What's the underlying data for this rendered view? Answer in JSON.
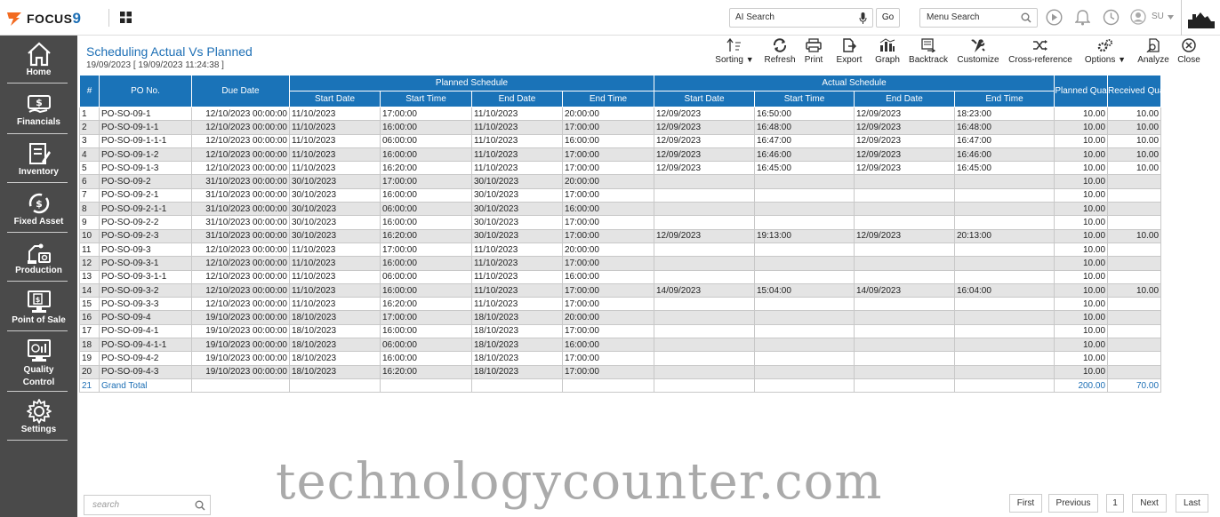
{
  "app": {
    "logo_text": "FOCUS",
    "logo_number": "9"
  },
  "topbar": {
    "ai_search_placeholder": "AI Search",
    "go_label": "Go",
    "menu_search_placeholder": "Menu Search",
    "user_initials": "SU"
  },
  "sidebar": {
    "items": [
      {
        "label": "Home",
        "icon": "home-icon"
      },
      {
        "label": "Financials",
        "icon": "financials-icon"
      },
      {
        "label": "Inventory",
        "icon": "inventory-icon"
      },
      {
        "label": "Fixed Asset",
        "icon": "fixed-asset-icon"
      },
      {
        "label": "Production",
        "icon": "production-icon"
      },
      {
        "label": "Point of Sale",
        "icon": "point-of-sale-icon"
      },
      {
        "label": "Quality Control",
        "icon": "quality-control-icon"
      },
      {
        "label": "Settings",
        "icon": "gear-icon"
      }
    ]
  },
  "report": {
    "title": "Scheduling Actual Vs Planned",
    "subtitle": "19/09/2023 [ 19/09/2023 11:24:38 ]"
  },
  "toolbar": {
    "sorting": "Sorting",
    "refresh": "Refresh",
    "print": "Print",
    "export": "Export",
    "graph": "Graph",
    "backtrack": "Backtrack",
    "customize": "Customize",
    "cross_reference": "Cross-reference",
    "options": "Options",
    "analyze": "Analyze",
    "close": "Close"
  },
  "table": {
    "headers": {
      "num": "#",
      "po_no": "PO No.",
      "due_date": "Due Date",
      "planned_group": "Planned Schedule",
      "actual_group": "Actual Schedule",
      "start_date": "Start Date",
      "start_time": "Start Time",
      "end_date": "End Date",
      "end_time": "End Time",
      "planned_qty": "Planned Qua",
      "received_qty": "Received Qua"
    },
    "rows": [
      [
        "1",
        "PO-SO-09-1",
        "12/10/2023 00:00:00",
        "11/10/2023",
        "17:00:00",
        "11/10/2023",
        "20:00:00",
        "12/09/2023",
        "16:50:00",
        "12/09/2023",
        "18:23:00",
        "10.00",
        "10.00"
      ],
      [
        "2",
        "PO-SO-09-1-1",
        "12/10/2023 00:00:00",
        "11/10/2023",
        "16:00:00",
        "11/10/2023",
        "17:00:00",
        "12/09/2023",
        "16:48:00",
        "12/09/2023",
        "16:48:00",
        "10.00",
        "10.00"
      ],
      [
        "3",
        "PO-SO-09-1-1-1",
        "12/10/2023 00:00:00",
        "11/10/2023",
        "06:00:00",
        "11/10/2023",
        "16:00:00",
        "12/09/2023",
        "16:47:00",
        "12/09/2023",
        "16:47:00",
        "10.00",
        "10.00"
      ],
      [
        "4",
        "PO-SO-09-1-2",
        "12/10/2023 00:00:00",
        "11/10/2023",
        "16:00:00",
        "11/10/2023",
        "17:00:00",
        "12/09/2023",
        "16:46:00",
        "12/09/2023",
        "16:46:00",
        "10.00",
        "10.00"
      ],
      [
        "5",
        "PO-SO-09-1-3",
        "12/10/2023 00:00:00",
        "11/10/2023",
        "16:20:00",
        "11/10/2023",
        "17:00:00",
        "12/09/2023",
        "16:45:00",
        "12/09/2023",
        "16:45:00",
        "10.00",
        "10.00"
      ],
      [
        "6",
        "PO-SO-09-2",
        "31/10/2023 00:00:00",
        "30/10/2023",
        "17:00:00",
        "30/10/2023",
        "20:00:00",
        "",
        "",
        "",
        "",
        "10.00",
        ""
      ],
      [
        "7",
        "PO-SO-09-2-1",
        "31/10/2023 00:00:00",
        "30/10/2023",
        "16:00:00",
        "30/10/2023",
        "17:00:00",
        "",
        "",
        "",
        "",
        "10.00",
        ""
      ],
      [
        "8",
        "PO-SO-09-2-1-1",
        "31/10/2023 00:00:00",
        "30/10/2023",
        "06:00:00",
        "30/10/2023",
        "16:00:00",
        "",
        "",
        "",
        "",
        "10.00",
        ""
      ],
      [
        "9",
        "PO-SO-09-2-2",
        "31/10/2023 00:00:00",
        "30/10/2023",
        "16:00:00",
        "30/10/2023",
        "17:00:00",
        "",
        "",
        "",
        "",
        "10.00",
        ""
      ],
      [
        "10",
        "PO-SO-09-2-3",
        "31/10/2023 00:00:00",
        "30/10/2023",
        "16:20:00",
        "30/10/2023",
        "17:00:00",
        "12/09/2023",
        "19:13:00",
        "12/09/2023",
        "20:13:00",
        "10.00",
        "10.00"
      ],
      [
        "11",
        "PO-SO-09-3",
        "12/10/2023 00:00:00",
        "11/10/2023",
        "17:00:00",
        "11/10/2023",
        "20:00:00",
        "",
        "",
        "",
        "",
        "10.00",
        ""
      ],
      [
        "12",
        "PO-SO-09-3-1",
        "12/10/2023 00:00:00",
        "11/10/2023",
        "16:00:00",
        "11/10/2023",
        "17:00:00",
        "",
        "",
        "",
        "",
        "10.00",
        ""
      ],
      [
        "13",
        "PO-SO-09-3-1-1",
        "12/10/2023 00:00:00",
        "11/10/2023",
        "06:00:00",
        "11/10/2023",
        "16:00:00",
        "",
        "",
        "",
        "",
        "10.00",
        ""
      ],
      [
        "14",
        "PO-SO-09-3-2",
        "12/10/2023 00:00:00",
        "11/10/2023",
        "16:00:00",
        "11/10/2023",
        "17:00:00",
        "14/09/2023",
        "15:04:00",
        "14/09/2023",
        "16:04:00",
        "10.00",
        "10.00"
      ],
      [
        "15",
        "PO-SO-09-3-3",
        "12/10/2023 00:00:00",
        "11/10/2023",
        "16:20:00",
        "11/10/2023",
        "17:00:00",
        "",
        "",
        "",
        "",
        "10.00",
        ""
      ],
      [
        "16",
        "PO-SO-09-4",
        "19/10/2023 00:00:00",
        "18/10/2023",
        "17:00:00",
        "18/10/2023",
        "20:00:00",
        "",
        "",
        "",
        "",
        "10.00",
        ""
      ],
      [
        "17",
        "PO-SO-09-4-1",
        "19/10/2023 00:00:00",
        "18/10/2023",
        "16:00:00",
        "18/10/2023",
        "17:00:00",
        "",
        "",
        "",
        "",
        "10.00",
        ""
      ],
      [
        "18",
        "PO-SO-09-4-1-1",
        "19/10/2023 00:00:00",
        "18/10/2023",
        "06:00:00",
        "18/10/2023",
        "16:00:00",
        "",
        "",
        "",
        "",
        "10.00",
        ""
      ],
      [
        "19",
        "PO-SO-09-4-2",
        "19/10/2023 00:00:00",
        "18/10/2023",
        "16:00:00",
        "18/10/2023",
        "17:00:00",
        "",
        "",
        "",
        "",
        "10.00",
        ""
      ],
      [
        "20",
        "PO-SO-09-4-3",
        "19/10/2023 00:00:00",
        "18/10/2023",
        "16:20:00",
        "18/10/2023",
        "17:00:00",
        "",
        "",
        "",
        "",
        "10.00",
        ""
      ]
    ],
    "total_row": [
      "21",
      "Grand Total",
      "",
      "",
      "",
      "",
      "",
      "",
      "",
      "",
      "",
      "200.00",
      "70.00"
    ]
  },
  "footer": {
    "search_placeholder": "search",
    "watermark": "technologycounter.com",
    "pager": {
      "first": "First",
      "previous": "Previous",
      "page": "1",
      "next": "Next",
      "last": "Last"
    }
  },
  "colors": {
    "header_blue": "#1a73b8",
    "title_blue": "#1d6fb5",
    "sidebar": "#4a4a4a",
    "logo_orange": "#f26b21"
  }
}
